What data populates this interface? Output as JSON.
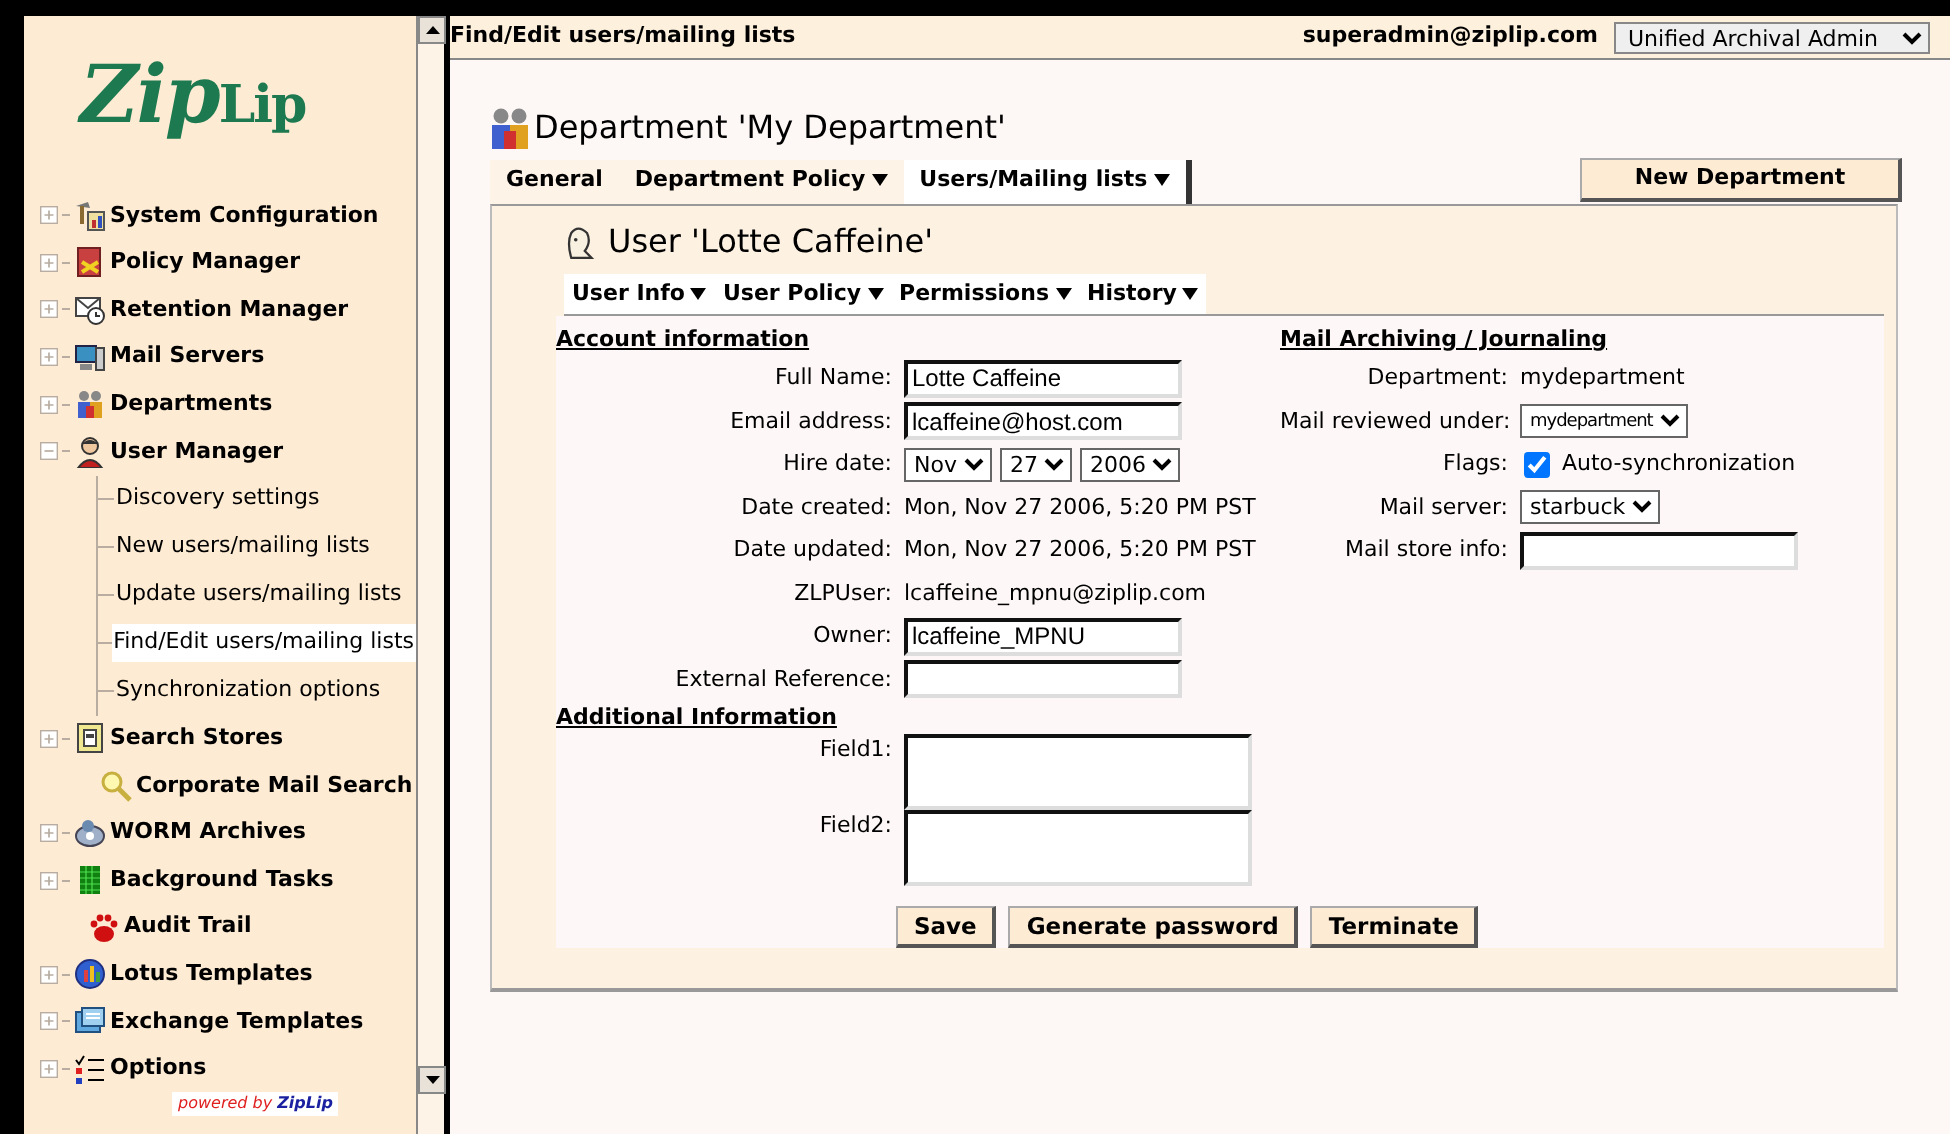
{
  "header": {
    "title": "Find/Edit users/mailing lists",
    "user": "superadmin@ziplip.com",
    "role": "Unified Archival Admin"
  },
  "sidebar": {
    "logo_a": "Zip",
    "logo_b": "Lip",
    "items": [
      {
        "label": "System Configuration",
        "kind": "node",
        "expanded": false
      },
      {
        "label": "Policy Manager",
        "kind": "node",
        "expanded": false
      },
      {
        "label": "Retention Manager",
        "kind": "node",
        "expanded": false
      },
      {
        "label": "Mail Servers",
        "kind": "node",
        "expanded": false
      },
      {
        "label": "Departments",
        "kind": "node",
        "expanded": false
      },
      {
        "label": "User Manager",
        "kind": "node",
        "expanded": true,
        "children": [
          {
            "label": "Discovery settings",
            "selected": false
          },
          {
            "label": "New users/mailing lists",
            "selected": false
          },
          {
            "label": "Update users/mailing lists",
            "selected": false
          },
          {
            "label": "Find/Edit users/mailing lists",
            "selected": true
          },
          {
            "label": "Synchronization options",
            "selected": false
          }
        ]
      },
      {
        "label": "Search Stores",
        "kind": "node",
        "expanded": false
      },
      {
        "label": "Corporate Mail Search",
        "kind": "leaf"
      },
      {
        "label": "WORM Archives",
        "kind": "node",
        "expanded": false
      },
      {
        "label": "Background Tasks",
        "kind": "node",
        "expanded": false
      },
      {
        "label": "Audit Trail",
        "kind": "leaf"
      },
      {
        "label": "Lotus Templates",
        "kind": "node",
        "expanded": false
      },
      {
        "label": "Exchange Templates",
        "kind": "node",
        "expanded": false
      },
      {
        "label": "Options",
        "kind": "node",
        "expanded": false
      }
    ],
    "powered_by": "powered by",
    "powered_brand": "ZipLip"
  },
  "department": {
    "title": "Department 'My Department'",
    "tabs": [
      {
        "label": "General",
        "menu": false,
        "selected": false
      },
      {
        "label": "Department Policy",
        "menu": true,
        "selected": false
      },
      {
        "label": "Users/Mailing lists",
        "menu": true,
        "selected": true
      }
    ],
    "new_button": "New Department"
  },
  "user": {
    "title": "User 'Lotte Caffeine'",
    "tabs": [
      {
        "label": "User Info",
        "menu": true
      },
      {
        "label": "User Policy",
        "menu": true
      },
      {
        "label": "Permissions",
        "menu": true
      },
      {
        "label": "History",
        "menu": true
      }
    ],
    "account": {
      "heading": "Account information",
      "rows": [
        {
          "label": "Full Name:",
          "kind": "input",
          "value": "Lotte Caffeine"
        },
        {
          "label": "Email address:",
          "kind": "input",
          "value": "lcaffeine@host.com"
        },
        {
          "label": "Hire date:",
          "kind": "date",
          "values": [
            "Nov",
            "27",
            "2006"
          ]
        },
        {
          "label": "Date created:",
          "kind": "text",
          "value": "Mon, Nov 27 2006, 5:20 PM PST"
        },
        {
          "label": "Date updated:",
          "kind": "text",
          "value": "Mon, Nov 27 2006, 5:20 PM PST"
        },
        {
          "label": "ZLPUser:",
          "kind": "text",
          "value": "lcaffeine_mpnu@ziplip.com"
        },
        {
          "label": "Owner:",
          "kind": "input",
          "value": "lcaffeine_MPNU"
        },
        {
          "label": "External Reference:",
          "kind": "input"
        }
      ]
    },
    "mail": {
      "heading": "Mail Archiving / Journaling",
      "rows": [
        {
          "label": "Department:",
          "kind": "text",
          "value": "mydepartment"
        },
        {
          "label": "Mail reviewed under:",
          "kind": "select",
          "value": "mydepartment"
        },
        {
          "label": "Flags:",
          "kind": "checkbox",
          "value": "Auto-synchronization",
          "checked": true
        },
        {
          "label": "Mail server:",
          "kind": "select",
          "value": "starbuck"
        },
        {
          "label": "Mail store info:",
          "kind": "input"
        }
      ]
    },
    "additional": {
      "heading": "Additional Information",
      "fields": [
        "Field1:",
        "Field2:"
      ]
    },
    "buttons": [
      "Save",
      "Generate password",
      "Terminate"
    ]
  }
}
